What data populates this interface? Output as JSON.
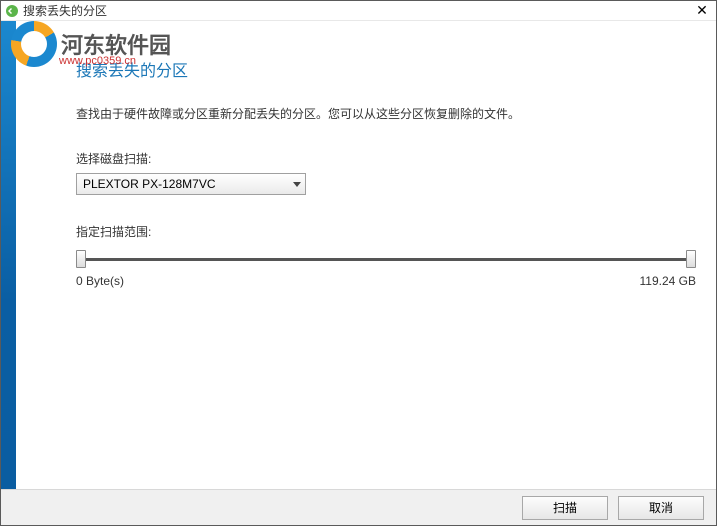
{
  "window": {
    "title": "搜索丢失的分区"
  },
  "watermark": {
    "brand": "河东软件园",
    "url": "www.pc0359.cn"
  },
  "header": "搜索丢失的分区",
  "description": "查找由于硬件故障或分区重新分配丢失的分区。您可以从这些分区恢复删除的文件。",
  "diskSelect": {
    "label": "选择磁盘扫描:",
    "selected": "PLEXTOR PX-128M7VC"
  },
  "range": {
    "label": "指定扫描范围:",
    "min": "0 Byte(s)",
    "max": "119.24 GB"
  },
  "buttons": {
    "scan": "扫描",
    "cancel": "取消"
  }
}
